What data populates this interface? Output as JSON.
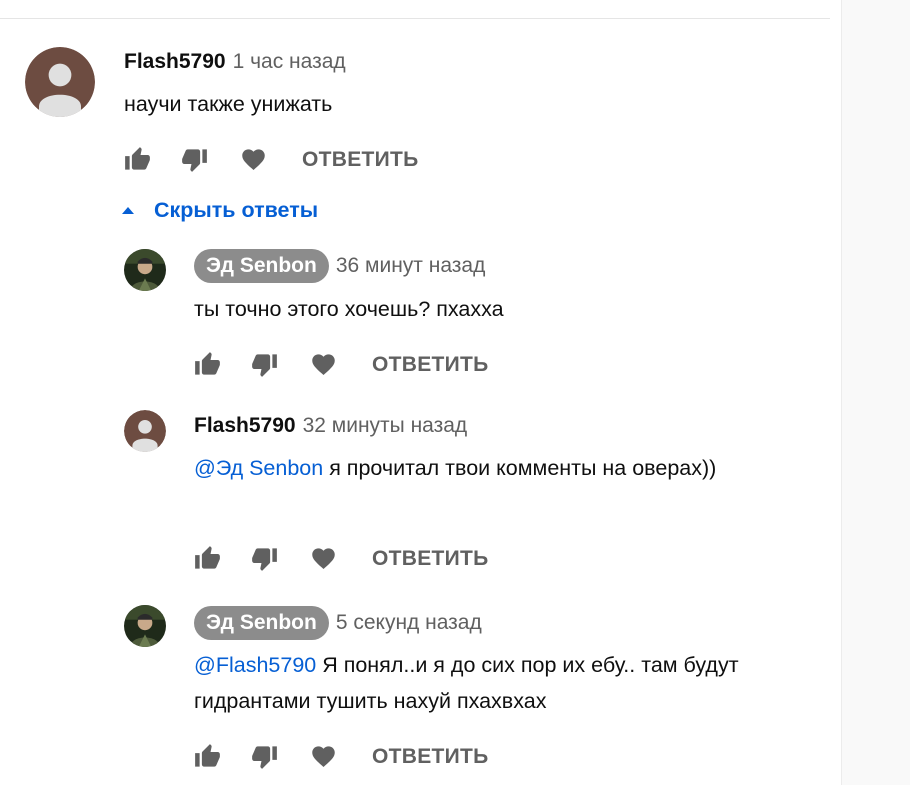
{
  "comments": [
    {
      "author": "Flash5790",
      "time": "1 час назад",
      "mention": "",
      "text": "научи также унижать",
      "reply_label": "ОТВЕТИТЬ",
      "avatar": "default-avatar-icon"
    }
  ],
  "replies_toggle": {
    "label": "Скрыть ответы"
  },
  "replies": [
    {
      "author": "Эд Senbon",
      "time": "36 минут назад",
      "mention": "",
      "text": "ты точно этого хочешь? пхахха",
      "reply_label": "ОТВЕТИТЬ",
      "avatar": "user-photo-avatar"
    },
    {
      "author": "Flash5790",
      "time": "32 минуты назад",
      "mention": "@Эд Senbon",
      "text": " я прочитал твои комменты на оверах))",
      "reply_label": "ОТВЕТИТЬ",
      "avatar": "default-avatar-icon"
    },
    {
      "author": "Эд Senbon",
      "time": "5 секунд назад",
      "mention": "@Flash5790",
      "text": " Я понял..и я до сих пор их ебу.. там будут гидрантами тушить нахуй пхахвхах",
      "reply_label": "ОТВЕТИТЬ",
      "avatar": "user-photo-avatar"
    }
  ],
  "colors": {
    "link": "#065fd4",
    "secondary_text": "#606060",
    "icon": "#606060",
    "default_avatar_bg": "#6d4c41",
    "author_chip_bg": "#8c8c8c"
  }
}
